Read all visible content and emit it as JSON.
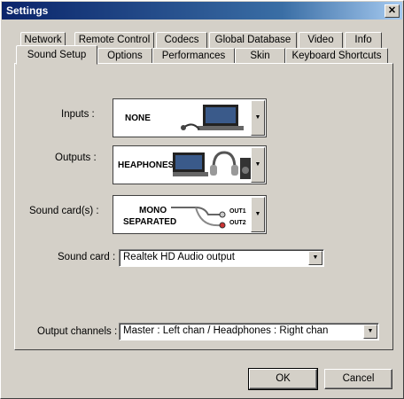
{
  "window": {
    "title": "Settings",
    "close_glyph": "✕"
  },
  "tabs_row1": [
    "Network",
    "Remote Control",
    "Codecs",
    "Global Database",
    "Video",
    "Info"
  ],
  "tabs_row2": [
    "Sound Setup",
    "Options",
    "Performances",
    "Skin",
    "Keyboard Shortcuts"
  ],
  "active_tab": "Sound Setup",
  "sound_setup": {
    "inputs_label": "Inputs :",
    "inputs_value": "NONE",
    "outputs_label": "Outputs :",
    "outputs_value": "HEAPHONES",
    "soundcards_label": "Sound card(s) :",
    "soundcards_value_line1": "MONO",
    "soundcards_value_line2": "SEPARATED",
    "out1": "OUT1",
    "out2": "OUT2",
    "soundcard_label": "Sound card :",
    "soundcard_value": "Realtek HD Audio output",
    "output_channels_label": "Output channels :",
    "output_channels_value": "Master : Left chan / Headphones : Right chan"
  },
  "buttons": {
    "ok": "OK",
    "cancel": "Cancel"
  },
  "icons": [
    "close-icon",
    "dropdown-arrow-icon",
    "laptop-icon",
    "headphones-icon",
    "speaker-icon",
    "cable-icon"
  ]
}
